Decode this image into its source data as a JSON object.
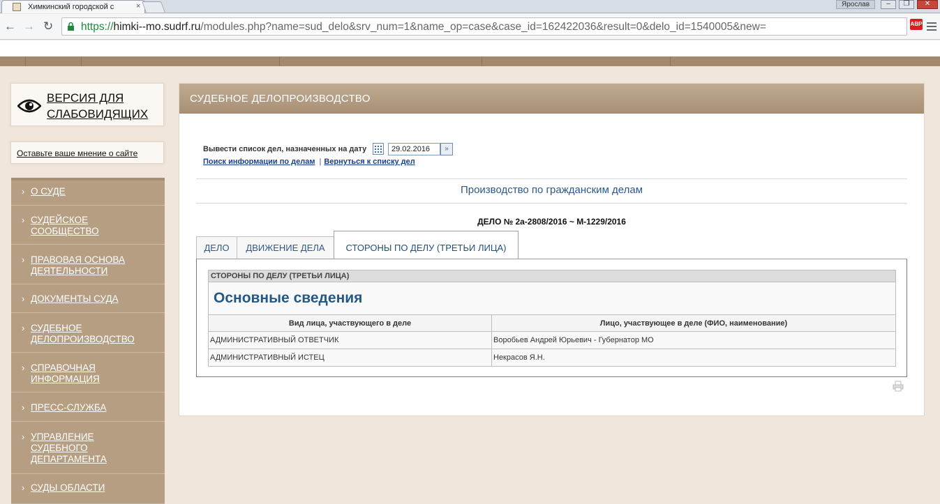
{
  "browser": {
    "tab_title": "Химкинский городской с",
    "tab_close": "×",
    "user_badge": "Ярослав",
    "url_scheme": "https://",
    "url_host": "himki--mo.sudrf.ru",
    "url_path": "/modules.php?name=sud_delo&srv_num=1&name_op=case&case_id=162422036&result=0&delo_id=1540005&new=",
    "ext_label": "ABP"
  },
  "sidebar": {
    "vision_label": "ВЕРСИЯ ДЛЯ СЛАБОВИДЯЩИХ",
    "feedback_label": "Оставьте ваше мнение о сайте",
    "items": [
      {
        "label": "О СУДЕ"
      },
      {
        "label": "СУДЕЙСКОЕ СООБЩЕСТВО"
      },
      {
        "label": "ПРАВОВАЯ ОСНОВА ДЕЯТЕЛЬНОСТИ"
      },
      {
        "label": "ДОКУМЕНТЫ СУДА"
      },
      {
        "label": "СУДЕБНОЕ ДЕЛОПРОИЗВОДСТВО"
      },
      {
        "label": "СПРАВОЧНАЯ ИНФОРМАЦИЯ"
      },
      {
        "label": "ПРЕСС-СЛУЖБА"
      },
      {
        "label": "УПРАВЛЕНИЕ СУДЕБНОГО ДЕПАРТАМЕНТА"
      },
      {
        "label": "СУДЫ ОБЛАСТИ"
      }
    ]
  },
  "main": {
    "title": "СУДЕБНОЕ ДЕЛОПРОИЗВОДСТВО",
    "date_label": "Вывести список дел, назначенных на дату",
    "date_value": "29.02.2016",
    "link_search": "Поиск информации по делам",
    "link_separator": "|",
    "link_back": "Вернуться к списку дел",
    "section_title": "Производство по гражданским делам",
    "case_title": "ДЕЛО № 2а-2808/2016 ~ М-1229/2016",
    "tabs": [
      {
        "label": "ДЕЛО"
      },
      {
        "label": "ДВИЖЕНИЕ ДЕЛА"
      },
      {
        "label": "СТОРОНЫ ПО ДЕЛУ (ТРЕТЬИ ЛИЦА)"
      }
    ],
    "table": {
      "caption": "СТОРОНЫ ПО ДЕЛУ (ТРЕТЬИ ЛИЦА)",
      "heading": "Основные сведения",
      "columns": [
        "Вид лица, участвующего в деле",
        "Лицо, участвующее в деле (ФИО, наименование)"
      ],
      "rows": [
        [
          "АДМИНИСТРАТИВНЫЙ ОТВЕТЧИК",
          "Воробьев Андрей Юрьевич - Губернатор МО"
        ],
        [
          "АДМИНИСТРАТИВНЫЙ ИСТЕЦ",
          "Некрасов Я.Н."
        ]
      ]
    }
  }
}
